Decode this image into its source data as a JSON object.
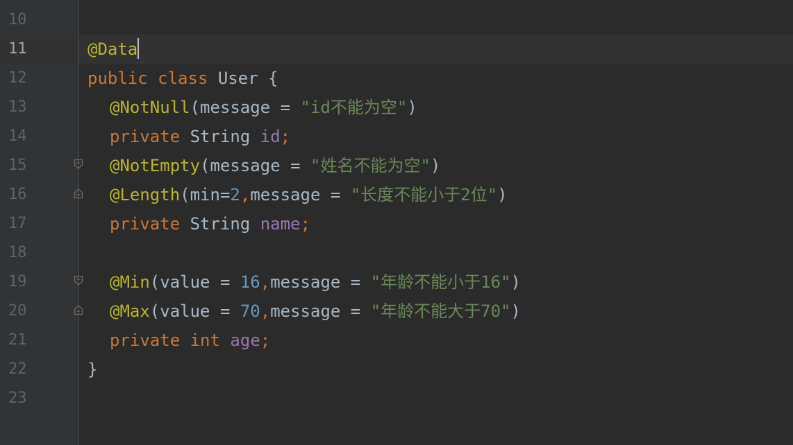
{
  "line_numbers": [
    "10",
    "11",
    "12",
    "13",
    "14",
    "15",
    "16",
    "17",
    "18",
    "19",
    "20",
    "21",
    "22",
    "23"
  ],
  "code": {
    "l9_tail": ")",
    "l11_ann": "@Data",
    "l12_kw1": "public",
    "l12_kw2": "class",
    "l12_rest": "User {",
    "l13_ann": "@NotNull",
    "l13_p1": "(message = ",
    "l13_str": "\"id不能为空\"",
    "l13_p2": ")",
    "l14_kw": "private",
    "l14_type": "String",
    "l14_field": "id",
    "l14_semi": ";",
    "l15_ann": "@NotEmpty",
    "l15_p1": "(message = ",
    "l15_str": "\"姓名不能为空\"",
    "l15_p2": ")",
    "l16_ann": "@Length",
    "l16_p1": "(min=",
    "l16_num": "2",
    "l16_comma": ",",
    "l16_p2": "message = ",
    "l16_str": "\"长度不能小于2位\"",
    "l16_p3": ")",
    "l17_kw": "private",
    "l17_type": "String",
    "l17_field": "name",
    "l17_semi": ";",
    "l19_ann": "@Min",
    "l19_p1": "(value = ",
    "l19_num": "16",
    "l19_comma": ",",
    "l19_p2": "message = ",
    "l19_str": "\"年龄不能小于16\"",
    "l19_p3": ")",
    "l20_ann": "@Max",
    "l20_p1": "(value = ",
    "l20_num": "70",
    "l20_comma": ",",
    "l20_p2": "message = ",
    "l20_str": "\"年龄不能大于70\"",
    "l20_p3": ")",
    "l21_kw1": "private",
    "l21_kw2": "int",
    "l21_field": "age",
    "l21_semi": ";",
    "l22_brace": "}"
  },
  "colors": {
    "background": "#2b2b2b",
    "gutter": "#313335",
    "annotation": "#bbb529",
    "keyword": "#cc7832",
    "string": "#6a8759",
    "number": "#6897bb",
    "field": "#9876aa",
    "plain": "#a9b7c6"
  },
  "icons": [
    "fold-start-icon",
    "fold-end-icon"
  ]
}
